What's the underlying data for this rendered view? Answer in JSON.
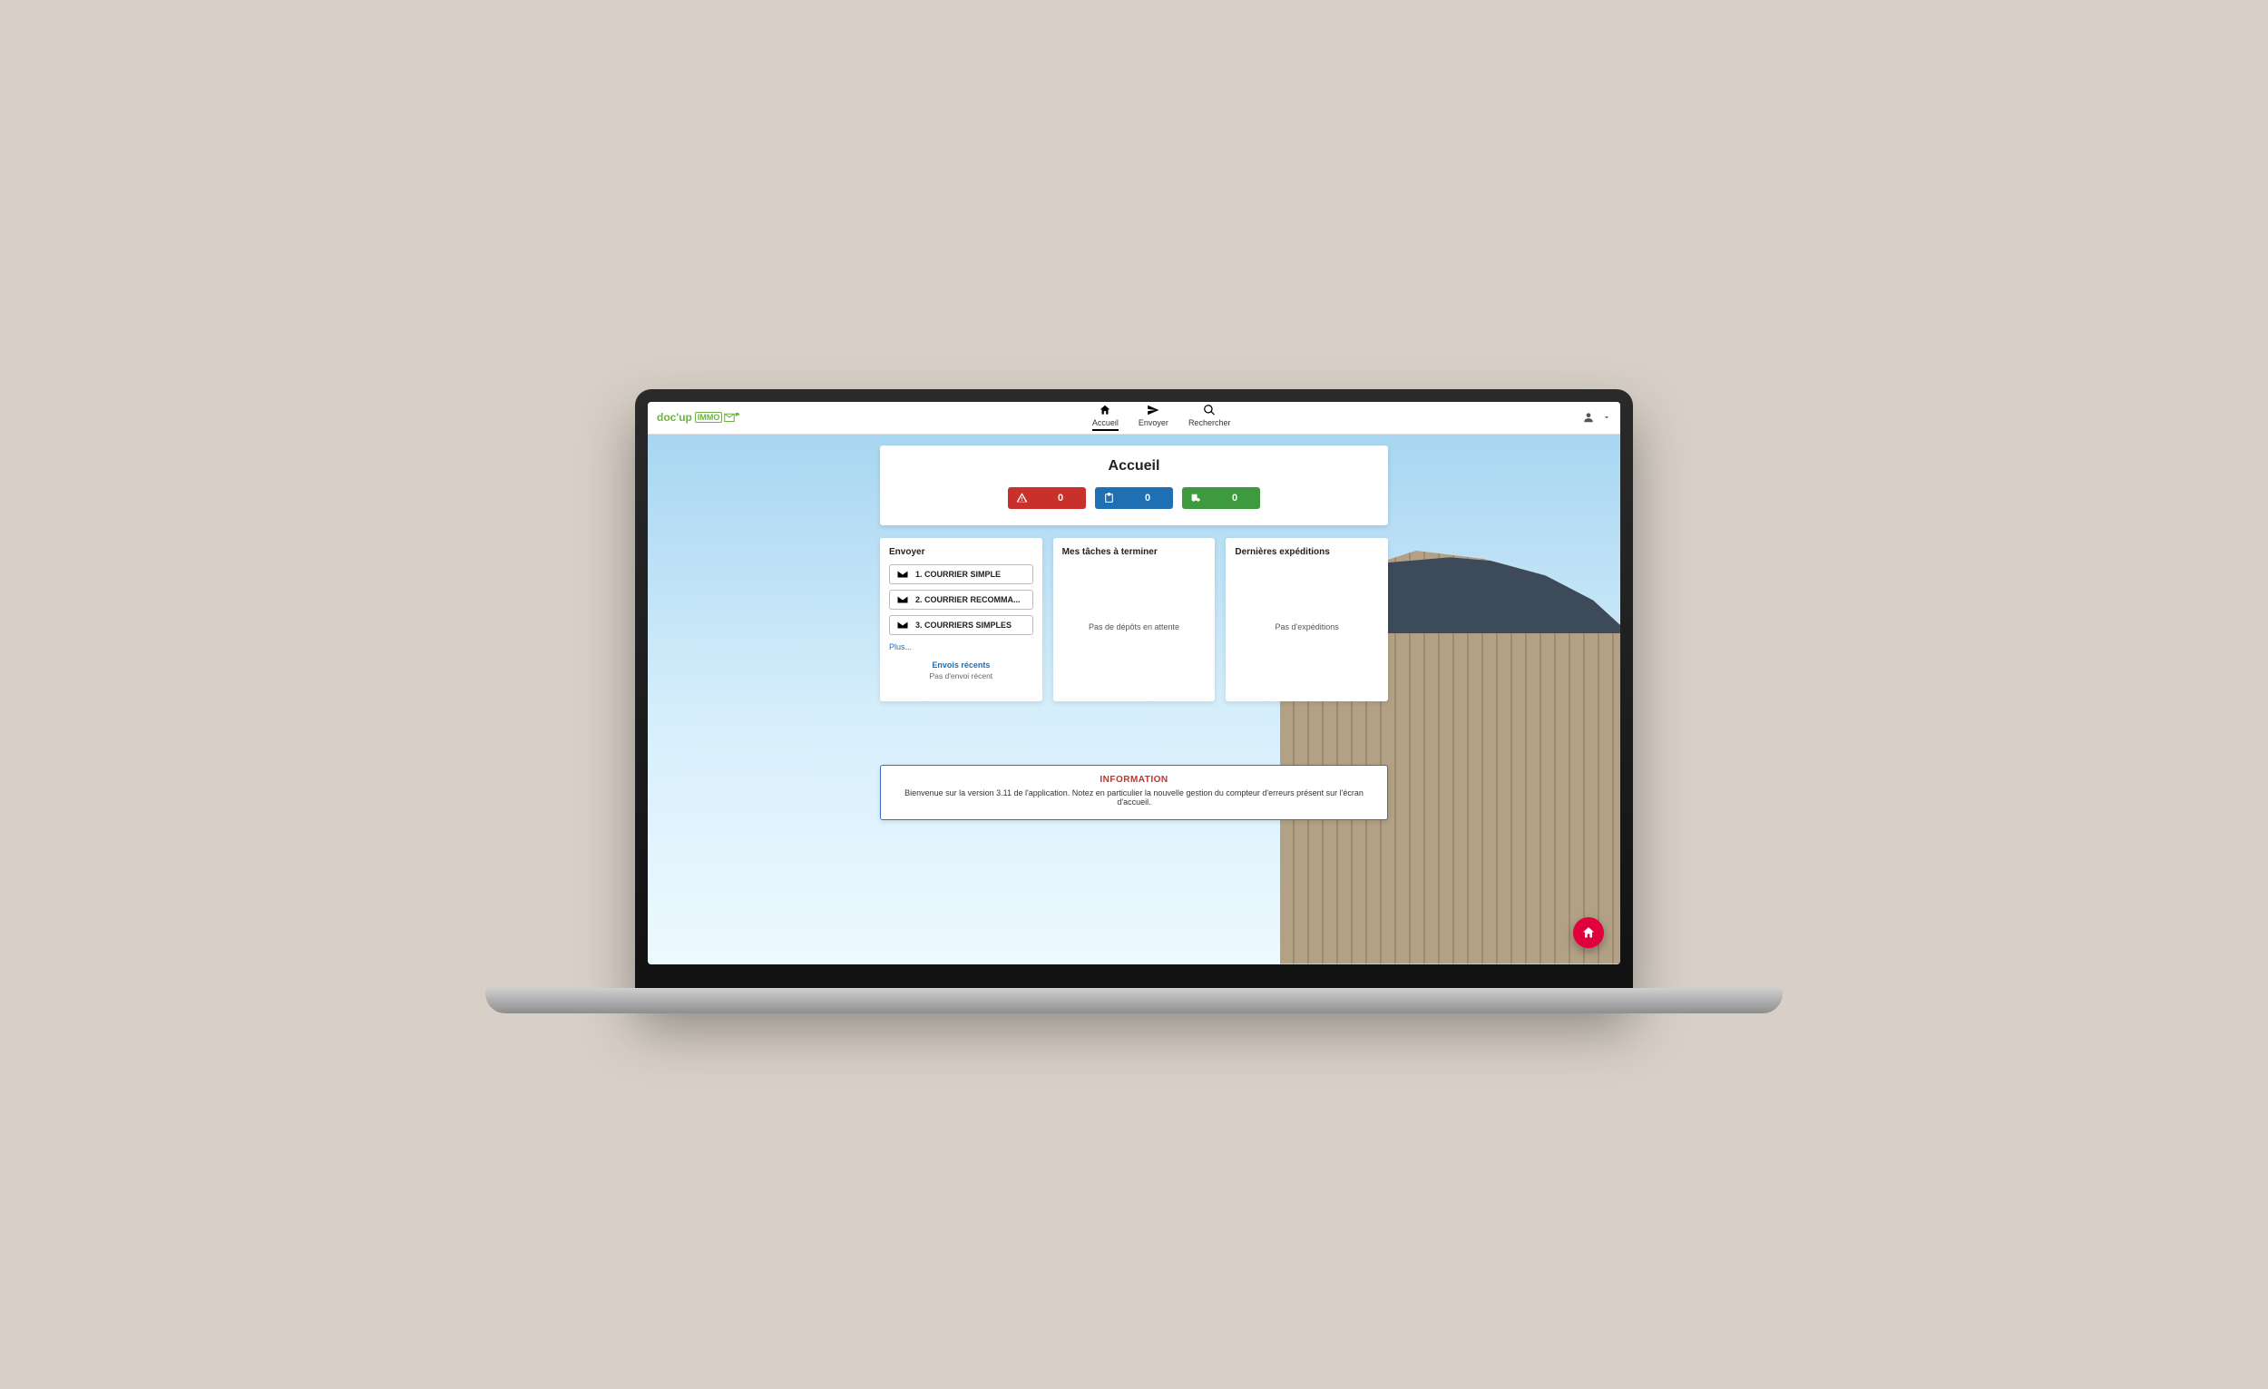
{
  "logo": {
    "part1": "doc'up",
    "part2": "IMMO"
  },
  "nav": {
    "accueil": "Accueil",
    "envoyer": "Envoyer",
    "rechercher": "Rechercher"
  },
  "user": {
    "label": ""
  },
  "page": {
    "title": "Accueil",
    "counters": {
      "alerts": "0",
      "tasks": "0",
      "shipments": "0"
    }
  },
  "columns": {
    "envoyer": {
      "title": "Envoyer",
      "options": [
        "1. COURRIER SIMPLE",
        "2. COURRIER RECOMMA...",
        "3. COURRIERS SIMPLES"
      ],
      "more": "Plus...",
      "recent_title": "Envois récents",
      "recent_empty": "Pas d'envoi récent"
    },
    "tasks": {
      "title": "Mes tâches à terminer",
      "empty": "Pas de dépôts en attente"
    },
    "shipments": {
      "title": "Dernières expéditions",
      "empty": "Pas d'expéditions"
    }
  },
  "info": {
    "title": "INFORMATION",
    "body": "Bienvenue sur la version 3.11 de l'application. Notez en particulier la nouvelle gestion du compteur d'erreurs présent sur l'écran d'accueil."
  }
}
